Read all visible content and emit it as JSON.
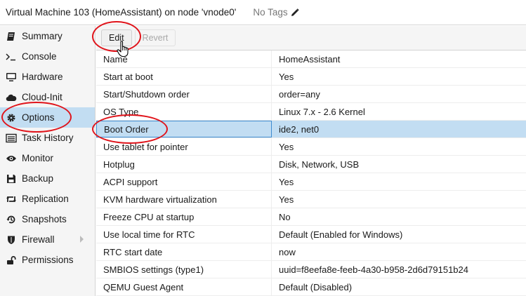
{
  "header": {
    "title": "Virtual Machine 103 (HomeAssistant) on node 'vnode0'",
    "tags": "No Tags"
  },
  "sidebar": {
    "items": [
      {
        "label": "Summary",
        "icon": "book-icon"
      },
      {
        "label": "Console",
        "icon": "terminal-icon"
      },
      {
        "label": "Hardware",
        "icon": "desktop-icon"
      },
      {
        "label": "Cloud-Init",
        "icon": "cloud-icon"
      },
      {
        "label": "Options",
        "icon": "gear-icon"
      },
      {
        "label": "Task History",
        "icon": "list-icon"
      },
      {
        "label": "Monitor",
        "icon": "eye-icon"
      },
      {
        "label": "Backup",
        "icon": "floppy-icon"
      },
      {
        "label": "Replication",
        "icon": "retweet-icon"
      },
      {
        "label": "Snapshots",
        "icon": "history-icon"
      },
      {
        "label": "Firewall",
        "icon": "shield-icon"
      },
      {
        "label": "Permissions",
        "icon": "unlock-icon"
      }
    ],
    "selected": "Options"
  },
  "toolbar": {
    "edit_label": "Edit",
    "revert_label": "Revert"
  },
  "options": {
    "rows": [
      {
        "key": "Name",
        "value": "HomeAssistant"
      },
      {
        "key": "Start at boot",
        "value": "Yes"
      },
      {
        "key": "Start/Shutdown order",
        "value": "order=any"
      },
      {
        "key": "OS Type",
        "value": "Linux 7.x - 2.6 Kernel"
      },
      {
        "key": "Boot Order",
        "value": "ide2, net0"
      },
      {
        "key": "Use tablet for pointer",
        "value": "Yes"
      },
      {
        "key": "Hotplug",
        "value": "Disk, Network, USB"
      },
      {
        "key": "ACPI support",
        "value": "Yes"
      },
      {
        "key": "KVM hardware virtualization",
        "value": "Yes"
      },
      {
        "key": "Freeze CPU at startup",
        "value": "No"
      },
      {
        "key": "Use local time for RTC",
        "value": "Default (Enabled for Windows)"
      },
      {
        "key": "RTC start date",
        "value": "now"
      },
      {
        "key": "SMBIOS settings (type1)",
        "value": "uuid=f8eefa8e-feeb-4a30-b958-2d6d79151b24"
      },
      {
        "key": "QEMU Guest Agent",
        "value": "Default (Disabled)"
      }
    ],
    "selected_key": "Boot Order"
  },
  "colors": {
    "selection": "#c2ddf2",
    "annotation": "#e0141b"
  }
}
